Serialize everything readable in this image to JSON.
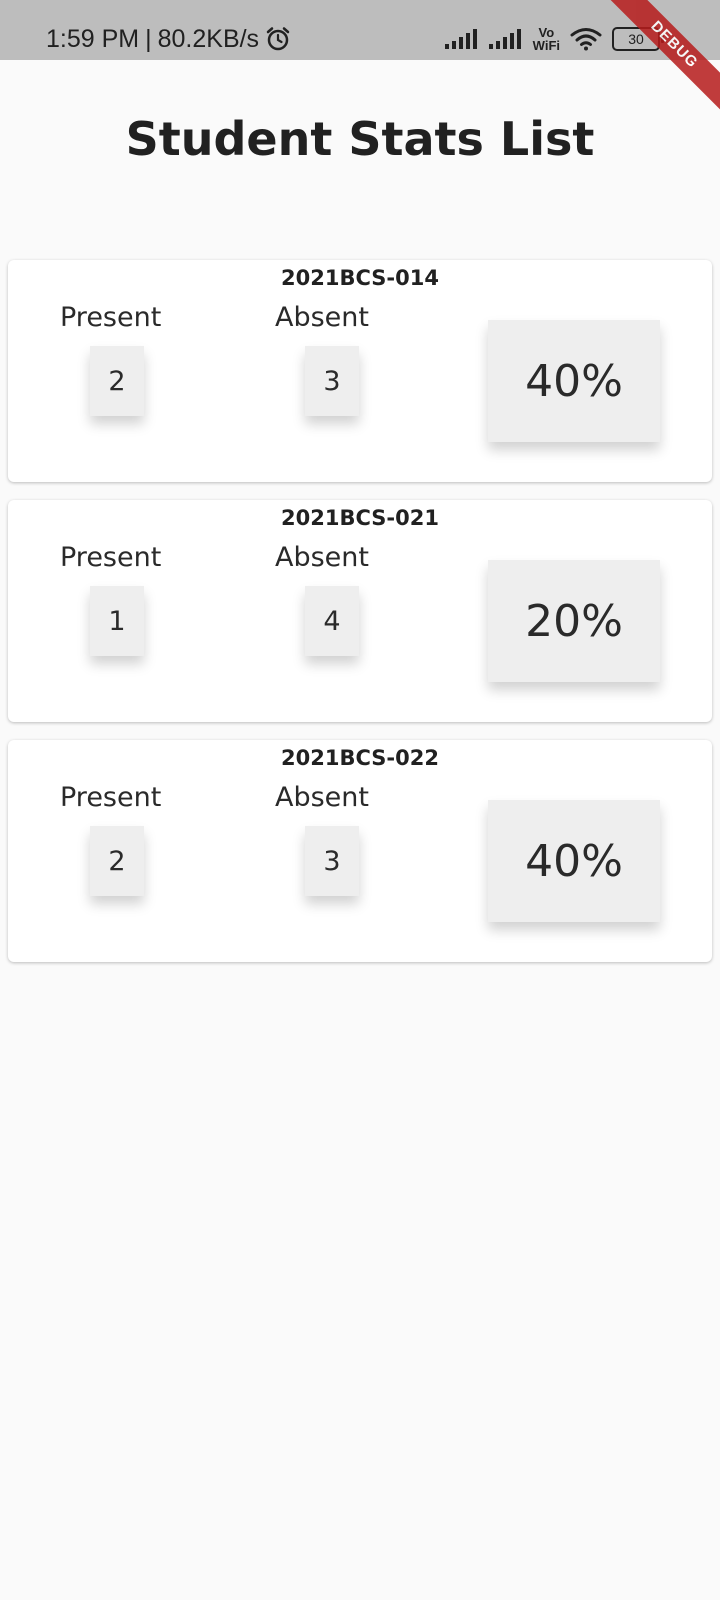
{
  "status_bar": {
    "time": "1:59 PM",
    "separator": "|",
    "speed": "80.2KB/s",
    "vowifi_top": "Vo",
    "vowifi_bottom": "WiFi",
    "battery": "30",
    "icons": [
      "alarm-icon",
      "signal-icon",
      "signal-icon",
      "wifi-icon",
      "battery-icon"
    ]
  },
  "debug_banner": "DEBUG",
  "page": {
    "title": "Student Stats List"
  },
  "students": [
    {
      "id": "2021BCS-014",
      "present_label": "Present",
      "absent_label": "Absent",
      "present": "2",
      "absent": "3",
      "percentage": "40%"
    },
    {
      "id": "2021BCS-021",
      "present_label": "Present",
      "absent_label": "Absent",
      "present": "1",
      "absent": "4",
      "percentage": "20%"
    },
    {
      "id": "2021BCS-022",
      "present_label": "Present",
      "absent_label": "Absent",
      "present": "2",
      "absent": "3",
      "percentage": "40%"
    }
  ],
  "colors": {
    "background": "#fafafa",
    "status_bar": "#bdbdbd",
    "card": "#ffffff",
    "box": "#eeeeee",
    "debug": "#b71c1c"
  }
}
